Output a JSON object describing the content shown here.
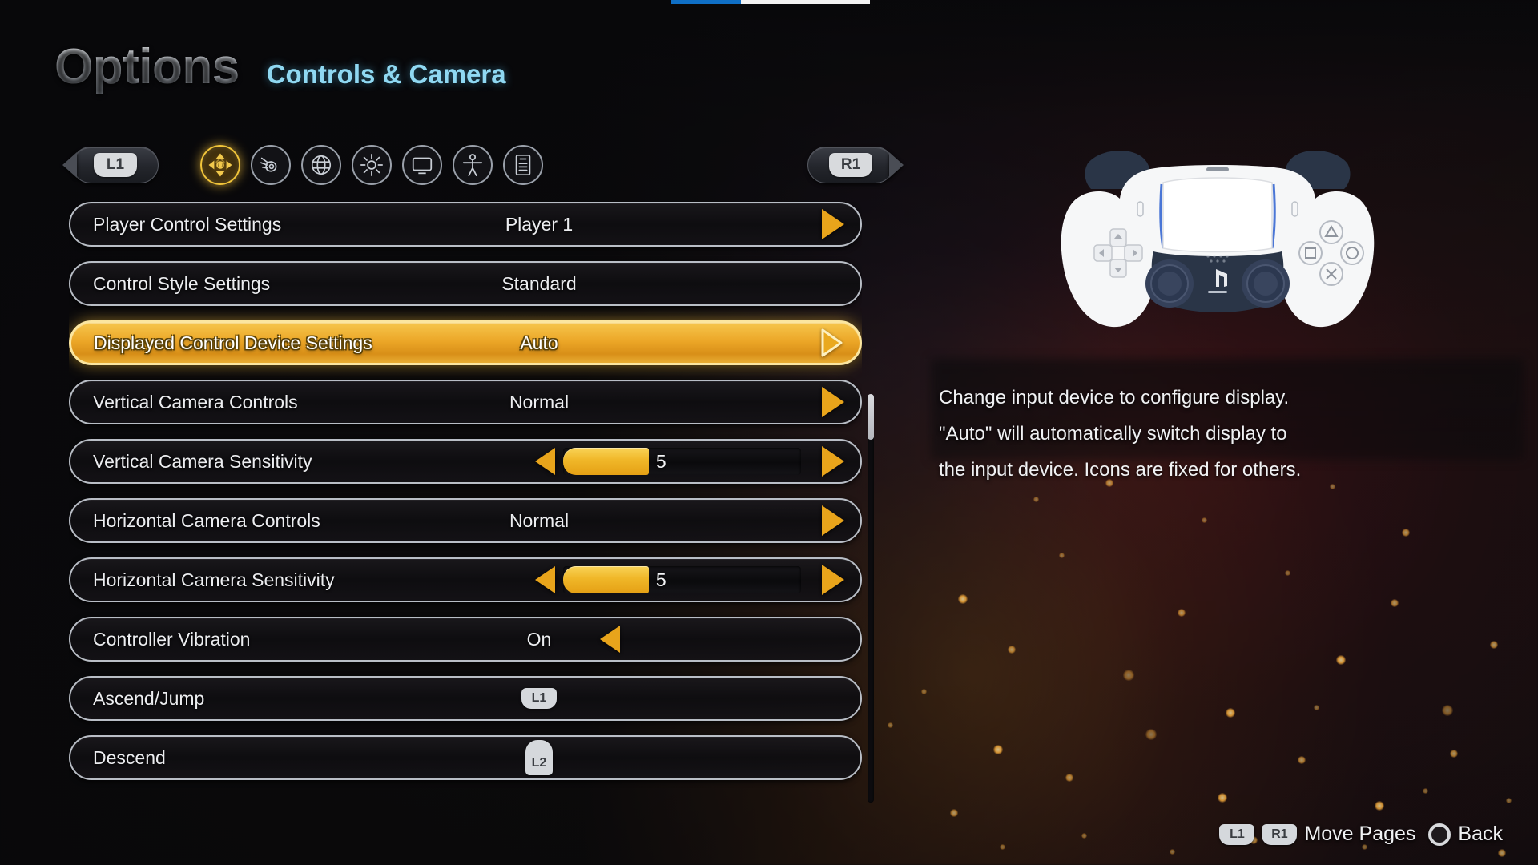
{
  "header": {
    "title": "Options",
    "subtitle": "Controls & Camera"
  },
  "topbar": {
    "progress_percent": 35
  },
  "tabbar": {
    "prev_page_label": "L1",
    "next_page_label": "R1",
    "icons": [
      {
        "name": "controls-icon",
        "label": "Controls & Camera",
        "active": true
      },
      {
        "name": "sound-icon",
        "label": "Sound",
        "active": false
      },
      {
        "name": "language-globe-icon",
        "label": "Language",
        "active": false
      },
      {
        "name": "brightness-sun-icon",
        "label": "Brightness",
        "active": false
      },
      {
        "name": "display-screen-icon",
        "label": "Display",
        "active": false
      },
      {
        "name": "accessibility-person-icon",
        "label": "Accessibility",
        "active": false
      },
      {
        "name": "notes-document-icon",
        "label": "Notes",
        "active": false
      }
    ]
  },
  "options": [
    {
      "label": "Player Control Settings",
      "value": "Player 1",
      "type": "arrow"
    },
    {
      "label": "Control Style Settings",
      "value": "Standard",
      "type": "plain"
    },
    {
      "label": "Displayed Control Device Settings",
      "value": "Auto",
      "type": "arrow",
      "selected": true
    },
    {
      "label": "Vertical Camera Controls",
      "value": "Normal",
      "type": "arrow"
    },
    {
      "label": "Vertical Camera Sensitivity",
      "value": "5",
      "type": "slider",
      "fill_percent": 36
    },
    {
      "label": "Horizontal Camera Controls",
      "value": "Normal",
      "type": "arrow"
    },
    {
      "label": "Horizontal Camera Sensitivity",
      "value": "5",
      "type": "slider",
      "fill_percent": 36
    },
    {
      "label": "Controller Vibration",
      "value": "On",
      "type": "left-arrow"
    },
    {
      "label": "Ascend/Jump",
      "value": "L1",
      "type": "shoulder"
    },
    {
      "label": "Descend",
      "value": "L2",
      "type": "trigger"
    }
  ],
  "help": {
    "lines": [
      "Change input device to configure display.",
      "\"Auto\" will automatically switch display to",
      "the input device. Icons are fixed for others."
    ]
  },
  "controller": {
    "device_name": "DualSense Wireless Controller"
  },
  "footer": {
    "move_pages_key_l": "L1",
    "move_pages_key_r": "R1",
    "move_pages_label": "Move Pages",
    "back_label": "Back"
  },
  "colors": {
    "accent_gold": "#e8a41b",
    "selected_gold": "#eba526",
    "subtitle_cyan": "#8fd8f2",
    "row_border": "#b9bec6",
    "progress_blue": "#0f6fc6"
  },
  "scroll": {
    "thumb_position_percent": 0
  }
}
